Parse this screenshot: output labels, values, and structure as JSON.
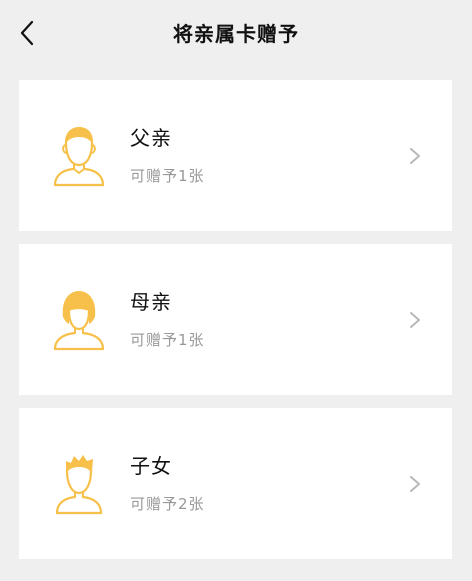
{
  "header": {
    "title": "将亲属卡赠予",
    "back_icon": "back-chevron-icon"
  },
  "relatives": [
    {
      "name": "父亲",
      "quota": "可赠予1张",
      "icon": "father-avatar-icon"
    },
    {
      "name": "母亲",
      "quota": "可赠予1张",
      "icon": "mother-avatar-icon"
    },
    {
      "name": "子女",
      "quota": "可赠予2张",
      "icon": "child-avatar-icon"
    }
  ],
  "colors": {
    "background": "#efefef",
    "card": "#ffffff",
    "accent": "#f7c04a",
    "title": "#111111",
    "subtext": "#999999",
    "chevron": "#b8b8b8"
  }
}
